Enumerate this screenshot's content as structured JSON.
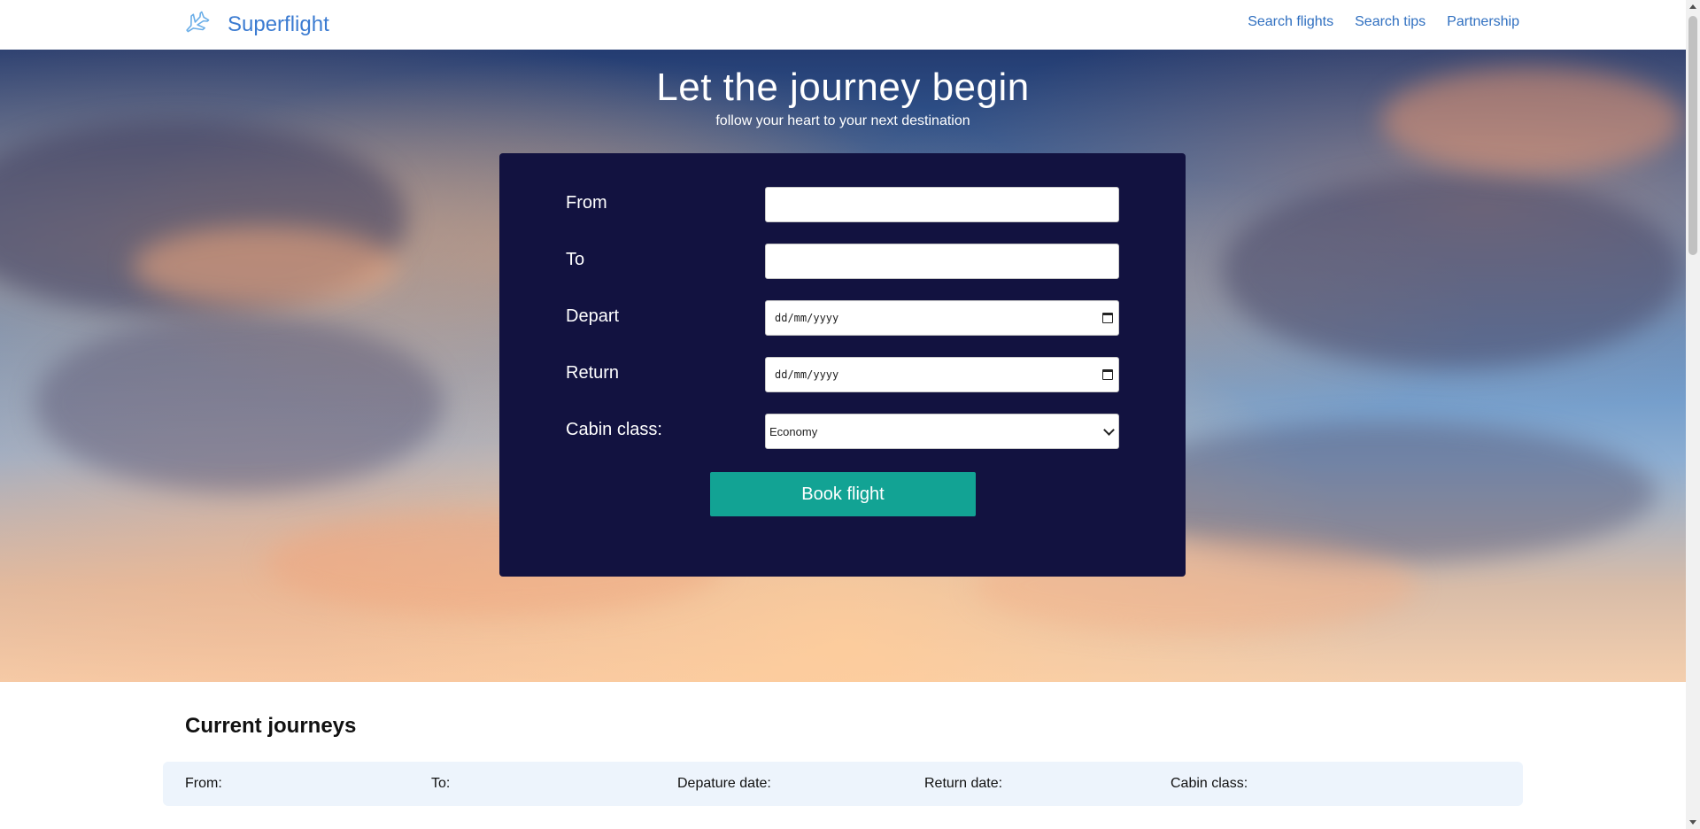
{
  "header": {
    "brand": "Superflight",
    "nav": [
      "Search flights",
      "Search tips",
      "Partnership"
    ]
  },
  "hero": {
    "title": "Let the journey begin",
    "subtitle": "follow your heart to your next destination"
  },
  "form": {
    "from_label": "From",
    "from_value": "",
    "to_label": "To",
    "to_value": "",
    "depart_label": "Depart",
    "depart_value": "dd/mm/yyyy",
    "return_label": "Return",
    "return_value": "dd/mm/yyyy",
    "cabin_label": "Cabin class:",
    "cabin_value": "Economy",
    "submit_label": "Book flight"
  },
  "journeys": {
    "title": "Current journeys",
    "columns": [
      "From:",
      "To:",
      "Depature date:",
      "Return date:",
      "Cabin class:"
    ]
  },
  "colors": {
    "brand": "#3b7bd1",
    "nav_link": "#2f6fc0",
    "card": "#121240",
    "button": "#12a394",
    "table_row": "#edf4fc"
  },
  "icons": {
    "logo": "airplane-icon",
    "date": "calendar-icon",
    "select": "chevron-down-icon"
  }
}
